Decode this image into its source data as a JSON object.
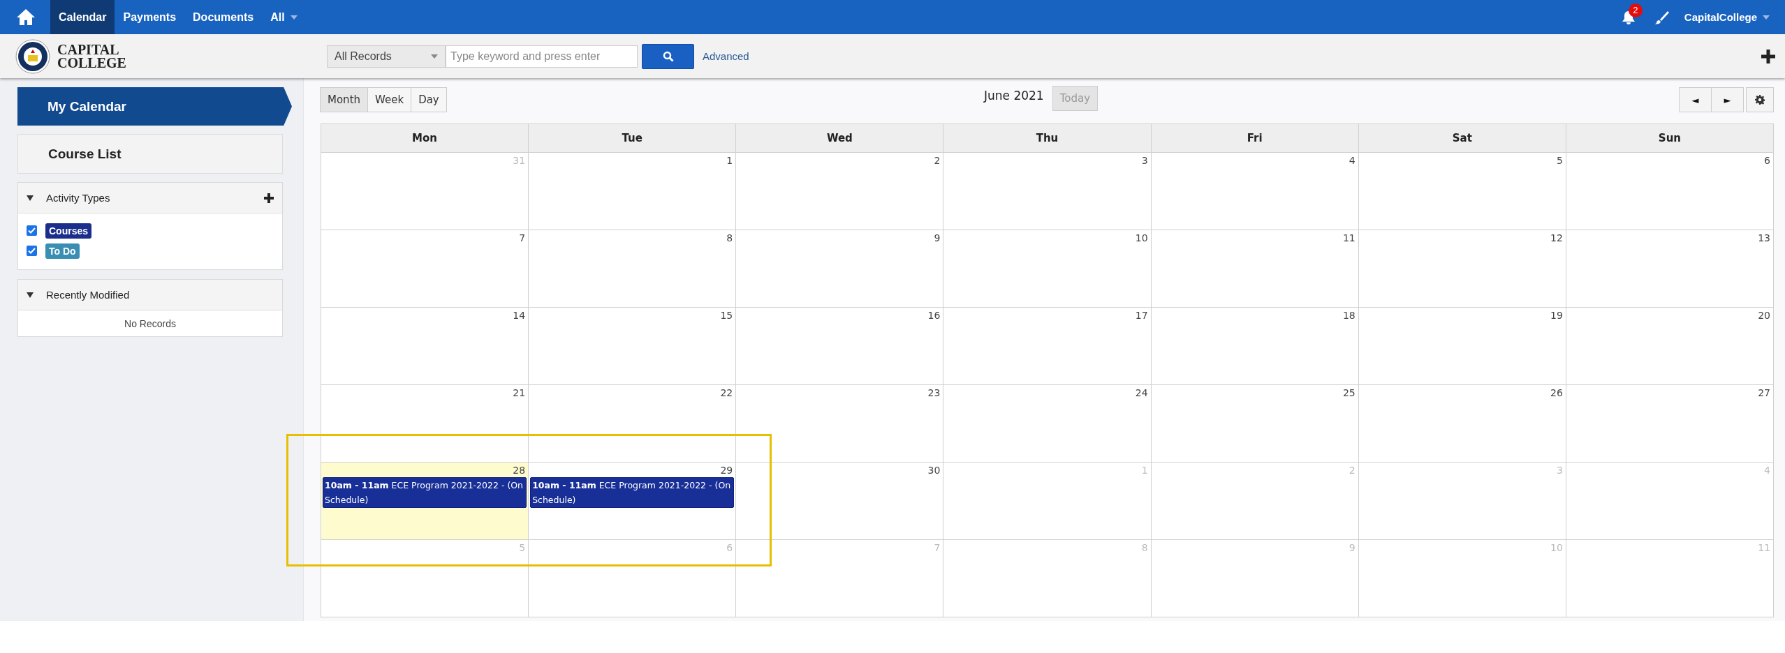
{
  "top_nav": {
    "items": [
      {
        "label": "Calendar",
        "selected": true
      },
      {
        "label": "Payments",
        "selected": false
      },
      {
        "label": "Documents",
        "selected": false
      },
      {
        "label": "All",
        "selected": false
      }
    ],
    "notification_count": "2",
    "user": "CapitalCollege"
  },
  "header": {
    "logo_lines": [
      "CAPITAL",
      "COLLEGE"
    ],
    "scope": "All Records",
    "search": {
      "placeholder": "Type keyword and press enter"
    },
    "advanced": "Advanced"
  },
  "sidebar": {
    "nav": [
      {
        "label": "My Calendar",
        "selected": true
      },
      {
        "label": "Course List",
        "selected": false
      }
    ],
    "activity_types": {
      "title": "Activity Types",
      "expanded": true,
      "items": [
        {
          "label": "Courses",
          "checked": true,
          "color": "#1c2e8c"
        },
        {
          "label": "To Do",
          "checked": true,
          "color": "#3a8db3"
        }
      ]
    },
    "recently_modified": {
      "title": "Recently Modified",
      "expanded": true,
      "empty_text": "No Records"
    }
  },
  "calendar": {
    "views": [
      {
        "label": "Month",
        "selected": true
      },
      {
        "label": "Week",
        "selected": false
      },
      {
        "label": "Day",
        "selected": false
      }
    ],
    "title": "June 2021",
    "today_button": "Today",
    "prev": "◄",
    "next": "►",
    "weekdays": [
      "Mon",
      "Tue",
      "Wed",
      "Thu",
      "Fri",
      "Sat",
      "Sun"
    ],
    "weeks": [
      [
        {
          "day": "31",
          "other_month": true,
          "today": false
        },
        {
          "day": "1",
          "other_month": false,
          "today": false
        },
        {
          "day": "2",
          "other_month": false,
          "today": false
        },
        {
          "day": "3",
          "other_month": false,
          "today": false
        },
        {
          "day": "4",
          "other_month": false,
          "today": false
        },
        {
          "day": "5",
          "other_month": false,
          "today": false
        },
        {
          "day": "6",
          "other_month": false,
          "today": false
        }
      ],
      [
        {
          "day": "7",
          "other_month": false,
          "today": false
        },
        {
          "day": "8",
          "other_month": false,
          "today": false
        },
        {
          "day": "9",
          "other_month": false,
          "today": false
        },
        {
          "day": "10",
          "other_month": false,
          "today": false
        },
        {
          "day": "11",
          "other_month": false,
          "today": false
        },
        {
          "day": "12",
          "other_month": false,
          "today": false
        },
        {
          "day": "13",
          "other_month": false,
          "today": false
        }
      ],
      [
        {
          "day": "14",
          "other_month": false,
          "today": false
        },
        {
          "day": "15",
          "other_month": false,
          "today": false
        },
        {
          "day": "16",
          "other_month": false,
          "today": false
        },
        {
          "day": "17",
          "other_month": false,
          "today": false
        },
        {
          "day": "18",
          "other_month": false,
          "today": false
        },
        {
          "day": "19",
          "other_month": false,
          "today": false
        },
        {
          "day": "20",
          "other_month": false,
          "today": false
        }
      ],
      [
        {
          "day": "21",
          "other_month": false,
          "today": false
        },
        {
          "day": "22",
          "other_month": false,
          "today": false
        },
        {
          "day": "23",
          "other_month": false,
          "today": false
        },
        {
          "day": "24",
          "other_month": false,
          "today": false
        },
        {
          "day": "25",
          "other_month": false,
          "today": false
        },
        {
          "day": "26",
          "other_month": false,
          "today": false
        },
        {
          "day": "27",
          "other_month": false,
          "today": false
        }
      ],
      [
        {
          "day": "28",
          "other_month": false,
          "today": true,
          "events": [
            "**10am - 11am** ECE Program 2021-2022 - (On Schedule)"
          ]
        },
        {
          "day": "29",
          "other_month": false,
          "today": false,
          "events": [
            "**10am - 11am** ECE Program 2021-2022 - (On Schedule)"
          ]
        },
        {
          "day": "30",
          "other_month": false,
          "today": false
        },
        {
          "day": "1",
          "other_month": true,
          "today": false
        },
        {
          "day": "2",
          "other_month": true,
          "today": false
        },
        {
          "day": "3",
          "other_month": true,
          "today": false
        },
        {
          "day": "4",
          "other_month": true,
          "today": false
        }
      ],
      [
        {
          "day": "5",
          "other_month": true,
          "today": false
        },
        {
          "day": "6",
          "other_month": true,
          "today": false
        },
        {
          "day": "7",
          "other_month": true,
          "today": false
        },
        {
          "day": "8",
          "other_month": true,
          "today": false
        },
        {
          "day": "9",
          "other_month": true,
          "today": false
        },
        {
          "day": "10",
          "other_month": true,
          "today": false
        },
        {
          "day": "11",
          "other_month": true,
          "today": false
        }
      ]
    ]
  },
  "annotation_frame": true
}
